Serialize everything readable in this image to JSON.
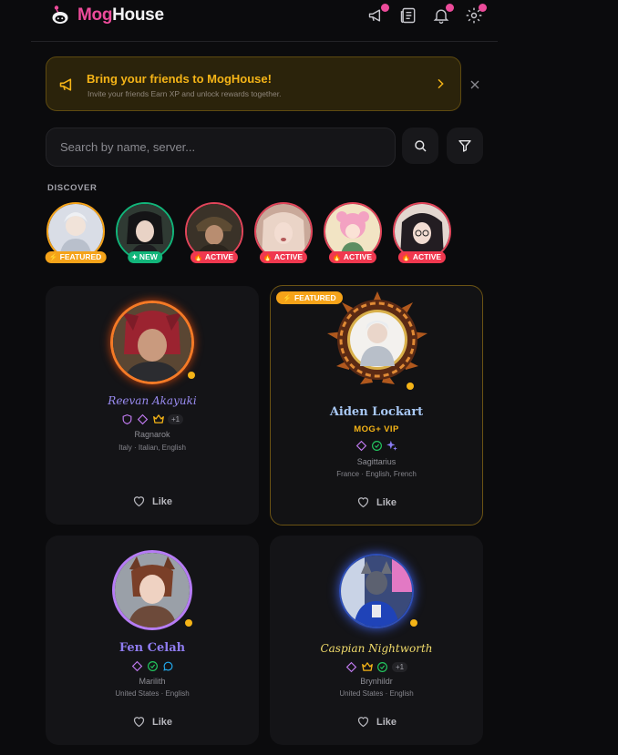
{
  "app": {
    "name_part1": "Mog",
    "name_part2": "House"
  },
  "banner": {
    "title": "Bring your friends to MogHouse!",
    "subtitle": "Invite your friends Earn XP and unlock rewards together."
  },
  "search": {
    "placeholder": "Search by name, server..."
  },
  "discover": {
    "label": "DISCOVER",
    "stories": [
      {
        "badge": "FEATURED",
        "badge_color": "#f5a319",
        "ring_color": "#f5a319"
      },
      {
        "badge": "NEW",
        "badge_color": "#12b57a",
        "ring_color": "#12b57a"
      },
      {
        "badge": "ACTIVE",
        "badge_color": "#f0384f",
        "ring_color": "#e2455a"
      },
      {
        "badge": "ACTIVE",
        "badge_color": "#f0384f",
        "ring_color": "#e2455a"
      },
      {
        "badge": "ACTIVE",
        "badge_color": "#f0384f",
        "ring_color": "#e2455a"
      },
      {
        "badge": "ACTIVE",
        "badge_color": "#f0384f",
        "ring_color": "#e2455a"
      }
    ]
  },
  "cards": [
    {
      "name": "Reevan Akayuki",
      "server": "Ragnarok",
      "location": "Italy · Italian, English",
      "more_badges": "+1",
      "like": "Like",
      "name_color": "#9a8cf2"
    },
    {
      "badge": "FEATURED",
      "name": "Aiden Lockart",
      "tier": "MOG+ VIP",
      "server": "Sagittarius",
      "location": "France · English, French",
      "like": "Like",
      "name_color": "#a8c8f5"
    },
    {
      "name": "Fen Celah",
      "server": "Marilith",
      "location": "United States · English",
      "like": "Like",
      "name_color": "#8f7cf0"
    },
    {
      "name": "Caspian Nightworth",
      "server": "Brynhildr",
      "location": "United States · English",
      "more_badges": "+1",
      "like": "Like",
      "name_color": "#f2dc6b"
    }
  ]
}
